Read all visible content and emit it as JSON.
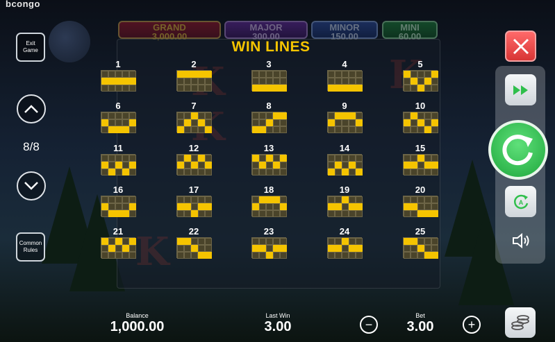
{
  "brand": "bcongo",
  "jackpots": {
    "grand": {
      "label": "GRAND",
      "value": "3,000.00"
    },
    "major": {
      "label": "MAJOR",
      "value": "300.00"
    },
    "minor": {
      "label": "MINOR",
      "value": "150.00"
    },
    "mini": {
      "label": "MINI",
      "value": "60.00"
    }
  },
  "title": "WIN LINES",
  "left_controls": {
    "exit_label": "Exit Game",
    "page_indicator": "8/8",
    "common_rules_label": "Common Rules"
  },
  "bottom": {
    "balance_label": "Balance",
    "balance_value": "1,000.00",
    "last_win_label": "Last Win",
    "last_win_value": "3.00",
    "bet_label": "Bet",
    "bet_value": "3.00"
  },
  "colors": {
    "line_on": "#f5c400",
    "line_off": "#4a442a",
    "title": "#f5c400",
    "spin": "#2fbf4b",
    "close": "#e84a4a"
  },
  "win_lines": [
    {
      "n": "1",
      "rows": [
        1,
        1,
        1,
        1,
        1
      ]
    },
    {
      "n": "2",
      "rows": [
        0,
        0,
        0,
        0,
        0
      ]
    },
    {
      "n": "3",
      "rows": [
        2,
        2,
        2,
        2,
        2
      ]
    },
    {
      "n": "4",
      "rows": [
        2,
        2,
        2,
        2,
        2
      ]
    },
    {
      "n": "5",
      "rows": [
        0,
        1,
        2,
        1,
        0
      ]
    },
    {
      "n": "6",
      "rows": [
        1,
        2,
        2,
        2,
        1
      ]
    },
    {
      "n": "7",
      "rows": [
        2,
        1,
        0,
        1,
        2
      ]
    },
    {
      "n": "8",
      "rows": [
        2,
        2,
        1,
        0,
        0
      ]
    },
    {
      "n": "9",
      "rows": [
        1,
        0,
        0,
        0,
        1
      ]
    },
    {
      "n": "10",
      "rows": [
        1,
        0,
        1,
        2,
        1
      ]
    },
    {
      "n": "11",
      "rows": [
        1,
        2,
        1,
        2,
        1
      ]
    },
    {
      "n": "12",
      "rows": [
        1,
        0,
        1,
        0,
        1
      ]
    },
    {
      "n": "13",
      "rows": [
        0,
        1,
        0,
        1,
        0
      ]
    },
    {
      "n": "14",
      "rows": [
        2,
        1,
        2,
        1,
        2
      ]
    },
    {
      "n": "15",
      "rows": [
        1,
        1,
        0,
        1,
        1
      ]
    },
    {
      "n": "16",
      "rows": [
        1,
        2,
        2,
        2,
        1
      ]
    },
    {
      "n": "17",
      "rows": [
        1,
        1,
        2,
        1,
        1
      ]
    },
    {
      "n": "18",
      "rows": [
        1,
        0,
        0,
        0,
        1
      ]
    },
    {
      "n": "19",
      "rows": [
        1,
        1,
        0,
        1,
        1
      ]
    },
    {
      "n": "20",
      "rows": [
        1,
        1,
        2,
        2,
        2
      ]
    },
    {
      "n": "21",
      "rows": [
        0,
        1,
        0,
        1,
        0
      ]
    },
    {
      "n": "22",
      "rows": [
        0,
        0,
        1,
        2,
        2
      ]
    },
    {
      "n": "23",
      "rows": [
        1,
        1,
        2,
        1,
        1
      ]
    },
    {
      "n": "24",
      "rows": [
        1,
        1,
        0,
        1,
        1
      ]
    },
    {
      "n": "25",
      "rows": [
        0,
        0,
        1,
        2,
        2
      ]
    }
  ]
}
